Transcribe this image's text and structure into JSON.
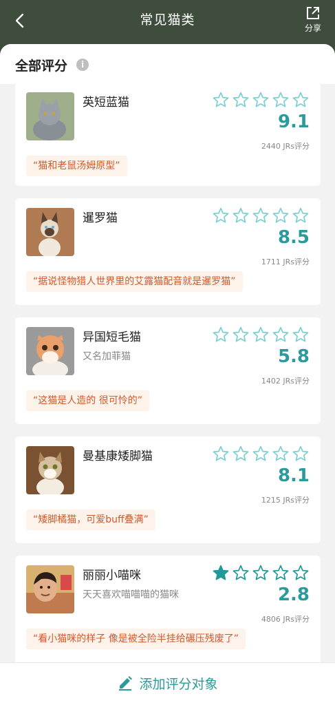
{
  "header": {
    "title": "常见猫类",
    "share_label": "分享"
  },
  "section": {
    "title": "全部评分",
    "info_glyph": "i"
  },
  "cards": [
    {
      "name": "英短蓝猫",
      "subtitle": "",
      "stars_filled": 0,
      "stars_total": 5,
      "score": "9.1",
      "count": "2440 JRs评分",
      "quote": "“猫和老鼠汤姆原型”"
    },
    {
      "name": "暹罗猫",
      "subtitle": "",
      "stars_filled": 0,
      "stars_total": 5,
      "score": "8.5",
      "count": "1711 JRs评分",
      "quote": "“据说怪物猎人世界里的艾露猫配音就是暹罗猫”"
    },
    {
      "name": "异国短毛猫",
      "subtitle": "又名加菲猫",
      "stars_filled": 0,
      "stars_total": 5,
      "score": "5.8",
      "count": "1402 JRs评分",
      "quote": "“这猫是人造的 很可怜的”"
    },
    {
      "name": "曼基康矮脚猫",
      "subtitle": "",
      "stars_filled": 0,
      "stars_total": 5,
      "score": "8.1",
      "count": "1215 JRs评分",
      "quote": "“矮脚橘猫，可爱buff叠满”"
    },
    {
      "name": "丽丽小喵咪",
      "subtitle": "天天喜欢喵喵喵的猫咪",
      "stars_filled": 1,
      "stars_total": 5,
      "score": "2.8",
      "count": "4806 JRs评分",
      "quote": "“看小猫咪的样子 像是被全险半挂给碾压残废了”"
    }
  ],
  "bottom": {
    "add_label": "添加评分对象"
  },
  "colors": {
    "header_bg": "#3f4e3c",
    "accent": "#2a9a9a",
    "quote_text": "#d15a2c",
    "quote_bg": "#fdf3ea"
  },
  "icons": [
    "back-arrow-icon",
    "share-icon",
    "info-icon",
    "star-icon",
    "pencil-icon"
  ]
}
